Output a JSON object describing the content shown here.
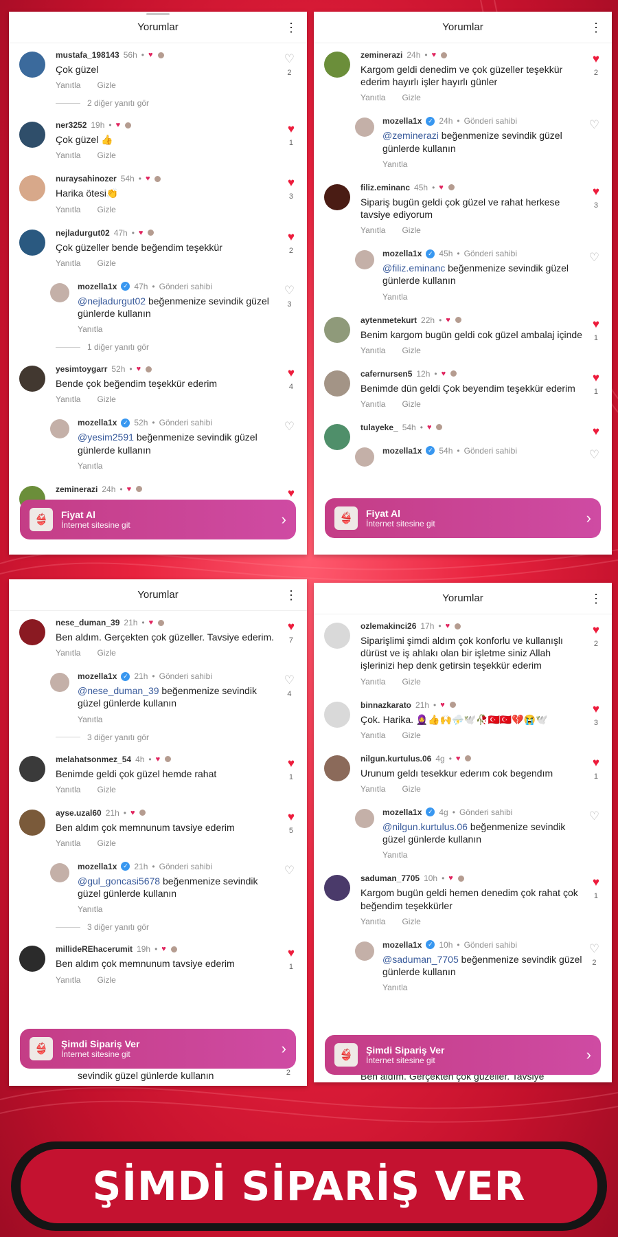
{
  "colors": {
    "accent": "#ed1c3c",
    "cta": "#c43d86",
    "banner_bg": "#c41230",
    "banner_border": "#151515",
    "mention": "#385a9b"
  },
  "panels": [
    {
      "title": "Yorumlar",
      "cta": {
        "title": "Fiyat Al",
        "subtitle": "İnternet sitesine git"
      },
      "comments": [
        {
          "user": "mustafa_198143",
          "time": "56h",
          "text": "Çok güzel",
          "likes": "2",
          "liked": false,
          "actions": [
            "Yanıtla",
            "Gizle"
          ],
          "avatar": "#3b6a9c",
          "see_more": "2 diğer yanıtı gör"
        },
        {
          "user": "ner3252",
          "time": "19h",
          "text": "Çok güzel 👍",
          "likes": "1",
          "liked": true,
          "actions": [
            "Yanıtla",
            "Gizle"
          ],
          "avatar": "#2f4e6a"
        },
        {
          "user": "nuraysahinozer",
          "time": "54h",
          "text": "Harika ötesi👏",
          "likes": "3",
          "liked": true,
          "actions": [
            "Yanıtla",
            "Gizle"
          ],
          "avatar": "#d7a88a"
        },
        {
          "user": "nejladurgut02",
          "time": "47h",
          "text": "Çok güzeller bende beğendim teşekkür",
          "likes": "2",
          "liked": true,
          "actions": [
            "Yanıtla",
            "Gizle"
          ],
          "avatar": "#2a5980"
        },
        {
          "reply": true,
          "user": "mozella1x",
          "verified": true,
          "time": "47h",
          "owner": "Gönderi sahibi",
          "mention": "@nejladurgut02",
          "text": "beğenmenize sevindik güzel günlerde kullanın",
          "likes": "3",
          "liked": false,
          "actions": [
            "Yanıtla"
          ],
          "avatar": "#c4b0a8",
          "see_more": "1 diğer yanıtı gör"
        },
        {
          "user": "yesimtoygarr",
          "time": "52h",
          "text": "Bende çok beğendim teşekkür ederim",
          "likes": "4",
          "liked": true,
          "actions": [
            "Yanıtla",
            "Gizle"
          ],
          "avatar": "#423830"
        },
        {
          "reply": true,
          "user": "mozella1x",
          "verified": true,
          "time": "52h",
          "owner": "Gönderi sahibi",
          "mention": "@yesim2591",
          "text": "beğenmenize sevindik güzel günlerde kullanın",
          "likes": "",
          "liked": false,
          "actions": [
            "Yanıtla"
          ],
          "avatar": "#c4b0a8"
        },
        {
          "user": "zeminerazi",
          "time": "24h",
          "text": "",
          "likes": "",
          "liked": true,
          "actions": [],
          "avatar": "#6b8e3a"
        }
      ]
    },
    {
      "title": "Yorumlar",
      "cta": {
        "title": "Fiyat Al",
        "subtitle": "İnternet sitesine git"
      },
      "comments": [
        {
          "user": "zeminerazi",
          "time": "24h",
          "text": "Kargom geldi denedim ve çok güzeller teşekkür ederim hayırlı işler hayırlı günler",
          "likes": "2",
          "liked": true,
          "actions": [
            "Yanıtla",
            "Gizle"
          ],
          "avatar": "#6b8e3a"
        },
        {
          "reply": true,
          "user": "mozella1x",
          "verified": true,
          "time": "24h",
          "owner": "Gönderi sahibi",
          "mention": "@zeminerazi",
          "text": "beğenmenize sevindik güzel günlerde kullanın",
          "likes": "",
          "liked": false,
          "actions": [
            "Yanıtla"
          ],
          "avatar": "#c4b0a8"
        },
        {
          "user": "filiz.eminanc",
          "time": "45h",
          "text": "Sipariş  bugün geldi  çok  güzel ve rahat herkese tavsiye ediyorum",
          "likes": "3",
          "liked": true,
          "actions": [
            "Yanıtla",
            "Gizle"
          ],
          "avatar": "#4a1c14"
        },
        {
          "reply": true,
          "user": "mozella1x",
          "verified": true,
          "time": "45h",
          "owner": "Gönderi sahibi",
          "mention": "@filiz.eminanc",
          "text": "beğenmenize sevindik güzel günlerde kullanın",
          "likes": "",
          "liked": false,
          "actions": [
            "Yanıtla"
          ],
          "avatar": "#c4b0a8"
        },
        {
          "user": "aytenmetekurt",
          "time": "22h",
          "text": "Benim  kargom bugün  geldi cok  güzel ambalaj içinde",
          "likes": "1",
          "liked": true,
          "actions": [
            "Yanıtla",
            "Gizle"
          ],
          "avatar": "#8f9a7a"
        },
        {
          "user": "cafernursen5",
          "time": "12h",
          "text": "Benimde dün geldi Çok  beyendim teşekkür ederim",
          "likes": "1",
          "liked": true,
          "actions": [
            "Yanıtla",
            "Gizle"
          ],
          "avatar": "#a39486"
        },
        {
          "user": "tulayeke_",
          "time": "54h",
          "text": "",
          "likes": "",
          "liked": true,
          "actions": [],
          "avatar": "#4f8f6a"
        },
        {
          "reply": true,
          "user": "mozella1x",
          "verified": true,
          "time": "54h",
          "owner": "Gönderi sahibi",
          "mention": "",
          "text": "",
          "likes": "",
          "liked": false,
          "actions": [],
          "avatar": "#c4b0a8"
        }
      ]
    },
    {
      "title": "Yorumlar",
      "cta": {
        "title": "Şimdi Sipariş Ver",
        "subtitle": "İnternet sitesine git"
      },
      "overflow_text": "sevindik güzel günlerde kullanın",
      "overflow_likes": "2",
      "comments": [
        {
          "user": "nese_duman_39",
          "time": "21h",
          "text": "Ben aldım. Gerçekten çok güzeller. Tavsiye ederim.",
          "likes": "7",
          "liked": true,
          "actions": [
            "Yanıtla",
            "Gizle"
          ],
          "avatar": "#8a1a22"
        },
        {
          "reply": true,
          "user": "mozella1x",
          "verified": true,
          "time": "21h",
          "owner": "Gönderi sahibi",
          "mention": "@nese_duman_39",
          "text": "beğenmenize sevindik güzel günlerde kullanın",
          "likes": "4",
          "liked": false,
          "actions": [
            "Yanıtla"
          ],
          "avatar": "#c4b0a8",
          "see_more": "3 diğer yanıtı gör"
        },
        {
          "user": "melahatsonmez_54",
          "time": "4h",
          "text": "Benimde geldi çok güzel hemde rahat",
          "likes": "1",
          "liked": true,
          "actions": [
            "Yanıtla",
            "Gizle"
          ],
          "avatar": "#3a3a3a"
        },
        {
          "user": "ayse.uzal60",
          "time": "21h",
          "text": "Ben aldım çok memnunum tavsiye ederim",
          "likes": "5",
          "liked": true,
          "actions": [
            "Yanıtla",
            "Gizle"
          ],
          "avatar": "#7a5a3a"
        },
        {
          "reply": true,
          "user": "mozella1x",
          "verified": true,
          "time": "21h",
          "owner": "Gönderi sahibi",
          "mention": "@gul_goncasi5678",
          "text": "beğenmenize sevindik güzel günlerde kullanın",
          "likes": "",
          "liked": false,
          "actions": [
            "Yanıtla"
          ],
          "avatar": "#c4b0a8",
          "see_more": "3 diğer yanıtı gör"
        },
        {
          "user": "millideREhacerumit",
          "time": "19h",
          "text": "Ben aldım çok memnunum tavsiye ederim",
          "likes": "1",
          "liked": true,
          "actions": [
            "Yanıtla",
            "Gizle"
          ],
          "avatar": "#2b2b2b"
        }
      ]
    },
    {
      "title": "Yorumlar",
      "cta": {
        "title": "Şimdi Sipariş Ver",
        "subtitle": "İnternet sitesine git"
      },
      "overflow_text": "Ben aldım. Gerçekten çok güzeller. Tavsiye",
      "comments": [
        {
          "user": "ozlemakinci26",
          "time": "17h",
          "text": "Siparişlimi şimdi aldım çok konforlu ve kullanışlı dürüst  ve iş ahlakı olan bir işletme siniz Allah işlerinizi hep denk getirsin teşekkür ederim",
          "likes": "2",
          "liked": true,
          "actions": [
            "Yanıtla",
            "Gizle"
          ],
          "avatar": "#d9d9d9"
        },
        {
          "user": "binnazkarato",
          "time": "21h",
          "text": "Çok. Harika. 🧕👍🙌⛈️🕊️🥀🇹🇷🇹🇷💔😭🕊️",
          "likes": "3",
          "liked": true,
          "actions": [
            "Yanıtla",
            "Gizle"
          ],
          "avatar": "#d9d9d9"
        },
        {
          "user": "nilgun.kurtulus.06",
          "time": "4g",
          "text": "Urunum geldı tesekkur ederım cok begendım",
          "likes": "1",
          "liked": true,
          "actions": [
            "Yanıtla",
            "Gizle"
          ],
          "avatar": "#8b6a5a"
        },
        {
          "reply": true,
          "user": "mozella1x",
          "verified": true,
          "time": "4g",
          "owner": "Gönderi sahibi",
          "mention": "@nilgun.kurtulus.06",
          "text": "beğenmenize sevindik güzel günlerde kullanın",
          "likes": "",
          "liked": false,
          "actions": [
            "Yanıtla"
          ],
          "avatar": "#c4b0a8"
        },
        {
          "user": "saduman_7705",
          "time": "10h",
          "text": "Kargom bugün geldi hemen denedim çok rahat çok beğendim teşekkürler",
          "likes": "1",
          "liked": true,
          "actions": [
            "Yanıtla",
            "Gizle"
          ],
          "avatar": "#4a3a6a"
        },
        {
          "reply": true,
          "user": "mozella1x",
          "verified": true,
          "time": "10h",
          "owner": "Gönderi sahibi",
          "mention": "@saduman_7705",
          "text": "beğenmenize sevindik güzel günlerde kullanın",
          "likes": "2",
          "liked": false,
          "actions": [
            "Yanıtla"
          ],
          "avatar": "#c4b0a8"
        }
      ]
    }
  ],
  "banner": {
    "text": "ŞİMDİ SİPARİŞ VER"
  }
}
